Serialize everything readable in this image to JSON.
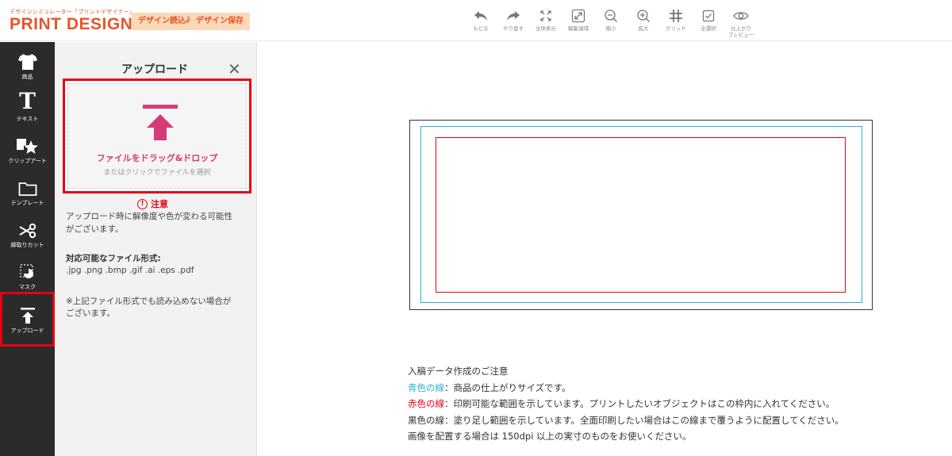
{
  "header": {
    "logo_sub": "デザインシミュレーター「プリントデザイナー」",
    "logo_main": "PRINT DESIGNER",
    "load_button": "デザイン読込み",
    "save_button": "デザイン保存"
  },
  "toolbar": [
    {
      "label": "もどる",
      "icon": "undo-icon"
    },
    {
      "label": "やり直す",
      "icon": "redo-icon"
    },
    {
      "label": "全体表示",
      "icon": "fit-view-icon"
    },
    {
      "label": "編集領域",
      "icon": "edit-area-icon"
    },
    {
      "label": "縮小",
      "icon": "zoom-out-icon"
    },
    {
      "label": "拡大",
      "icon": "zoom-in-icon"
    },
    {
      "label": "グリッド",
      "icon": "grid-icon"
    },
    {
      "label": "全選択",
      "icon": "select-all-icon"
    },
    {
      "label": "仕上がり",
      "label2": "プレビュー",
      "icon": "eye-icon"
    }
  ],
  "sidebar": {
    "items": [
      {
        "label": "商品",
        "icon": "tshirt-icon"
      },
      {
        "label": "テキスト",
        "icon": "text-icon"
      },
      {
        "label": "クリップアート",
        "icon": "clipart-icon"
      },
      {
        "label": "テンプレート",
        "icon": "folder-icon"
      },
      {
        "label": "縁取りカット",
        "icon": "scissors-icon"
      },
      {
        "label": "マスク",
        "icon": "mask-icon"
      },
      {
        "label": "アップロード",
        "icon": "upload-icon",
        "active": true
      }
    ]
  },
  "panel": {
    "title": "アップロード",
    "close": "✕",
    "drop_main": "ファイルをドラッグ&ドロップ",
    "drop_sub": "またはクリックでファイルを選択",
    "caution_mark": "!",
    "caution_label": "注意",
    "caution_text_1": "アップロード時に解像度や色が変わる可能性",
    "caution_text_2": "がございます。",
    "formats_title": "対応可能なファイル形式:",
    "formats": ".jpg .png .bmp .gif .ai .eps .pdf",
    "note_1": "※上記ファイル形式でも読み込めない場合が",
    "note_2": "ございます。"
  },
  "notes": {
    "heading": "入稿データ作成のご注意",
    "blue_label": "青色の線",
    "blue_text": "：商品の仕上がりサイズです。",
    "red_label": "赤色の線",
    "red_text": "：印刷可能な範囲を示しています。プリントしたいオブジェクトはこの枠内に入れてください。",
    "black_line": "黒色の線：塗り足し範囲を示しています。全面印刷したい場合はこの線まで覆うように配置してください。",
    "image_line": "画像を配置する場合は 150dpi 以上の実寸のものをお使いください。"
  },
  "colors": {
    "brand_orange": "#e8542a",
    "highlight_red": "#e60012",
    "accent_pink": "#d63c74",
    "guide_blue": "#2cb2d6",
    "sidebar_bg": "#2b2b2b"
  }
}
